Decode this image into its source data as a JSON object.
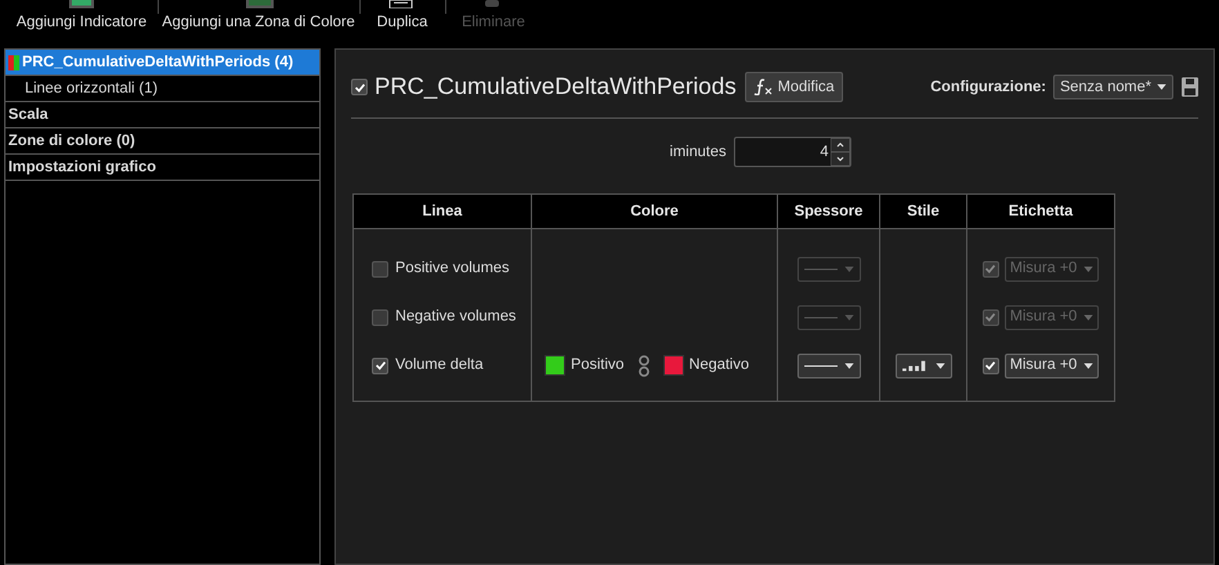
{
  "toolbar": [
    {
      "label": "Aggiungi Indicatore",
      "disabled": false
    },
    {
      "label": "Aggiungi una Zona di Colore",
      "disabled": false
    },
    {
      "label": "Duplica",
      "disabled": false
    },
    {
      "label": "Eliminare",
      "disabled": true
    }
  ],
  "sidebar": {
    "items": [
      {
        "label": "PRC_CumulativeDeltaWithPeriods (4)",
        "selected": true,
        "children": [
          {
            "label": "Linee orizzontali (1)",
            "selected": false
          }
        ]
      },
      {
        "label": "Scala",
        "selected": false
      },
      {
        "label": "Zone di colore (0)",
        "selected": false
      },
      {
        "label": "Impostazioni grafico",
        "selected": false
      }
    ]
  },
  "indicator": {
    "title": "PRC_CumulativeDeltaWithPeriods",
    "checked": true,
    "edit_button": "Modifica",
    "config_label": "Configurazione:",
    "config_value": "Senza nome*"
  },
  "parameter": {
    "label": "iminutes",
    "value": "4"
  },
  "table": {
    "columns": [
      "Linea",
      "Colore",
      "Spessore",
      "Stile",
      "Etichetta"
    ],
    "rows": [
      {
        "label": "Positive volumes",
        "checked": false,
        "label_checked": true,
        "label_value": "Misura +0"
      },
      {
        "label": "Negative volumes",
        "checked": false,
        "label_checked": true,
        "label_value": "Misura +0"
      },
      {
        "label": "Volume delta",
        "checked": true,
        "label_checked": true,
        "label_value": "Misura +0",
        "colors": [
          {
            "label": "Positivo",
            "color": "#33cc1a"
          },
          {
            "label": "Negativo",
            "color": "#e8183c"
          }
        ]
      }
    ]
  }
}
